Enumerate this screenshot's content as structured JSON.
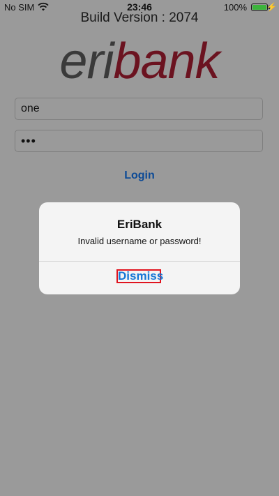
{
  "status_bar": {
    "carrier": "No SIM",
    "time": "23:46",
    "battery_percent": "100%",
    "wifi_icon": "wifi-icon",
    "battery_icon": "battery-icon",
    "charging_icon": "charging-bolt-icon"
  },
  "app": {
    "build_version": "Build Version : 2074",
    "logo_part1": "eri",
    "logo_part2": "bank",
    "logo_colors": {
      "eri": "#3a3a3a",
      "bank": "#6b1320"
    }
  },
  "login_form": {
    "username_value": "one",
    "password_value": "•••",
    "login_label": "Login"
  },
  "alert": {
    "title": "EriBank",
    "message": "Invalid username or password!",
    "dismiss_label": "Dismiss"
  }
}
